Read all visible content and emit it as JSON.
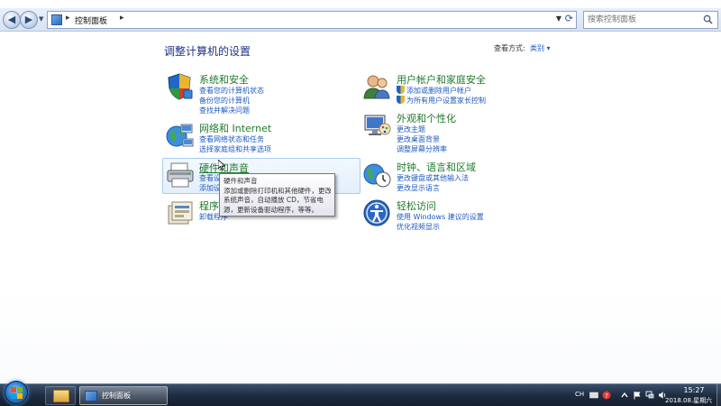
{
  "address": {
    "crumb": "控制面板",
    "separator": "▸",
    "search_placeholder": "搜索控制面板"
  },
  "header": {
    "title": "调整计算机的设置",
    "view_by_label": "查看方式:",
    "view_by_value": "类别 ▾"
  },
  "categories": {
    "system": {
      "title": "系统和安全",
      "links": [
        "查看您的计算机状态",
        "备份您的计算机",
        "查找并解决问题"
      ],
      "icon": "shield-icon"
    },
    "network": {
      "title": "网络和 Internet",
      "links": [
        "查看网络状态和任务",
        "选择家庭组和共享选项"
      ],
      "icon": "network-globe-icon"
    },
    "hardware": {
      "title": "硬件和声音",
      "links": [
        "查看设备和打印机",
        "添加设备"
      ],
      "icon": "printer-icon"
    },
    "programs": {
      "title": "程序",
      "links": [
        "卸载程序"
      ],
      "icon": "programs-icon"
    },
    "users": {
      "title": "用户帐户和家庭安全",
      "links": [
        "添加或删除用户帐户",
        "为所有用户设置家长控制"
      ],
      "icon": "users-icon"
    },
    "appearance": {
      "title": "外观和个性化",
      "links": [
        "更改主题",
        "更改桌面背景",
        "调整屏幕分辨率"
      ],
      "icon": "appearance-icon"
    },
    "clock": {
      "title": "时钟、语言和区域",
      "links": [
        "更改键盘或其他输入法",
        "更改显示语言"
      ],
      "icon": "clock-globe-icon"
    },
    "ease": {
      "title": "轻松访问",
      "links": [
        "使用 Windows 建议的设置",
        "优化视频显示"
      ],
      "icon": "ease-of-access-icon"
    }
  },
  "tooltip": {
    "lines": [
      "硬件和声音",
      "添加或删除打印机和其他硬件，更改",
      "系统声音，自动播放 CD，节省电",
      "源，更新设备驱动程序，等等。"
    ]
  },
  "taskbar": {
    "task_label": "控制面板",
    "lang": "CH",
    "time": "15:27",
    "date": "2018.08.星期六"
  },
  "colors": {
    "title_blue": "#1e3287",
    "category_green": "#1f7a2a",
    "link_blue": "#1e5ac2"
  }
}
